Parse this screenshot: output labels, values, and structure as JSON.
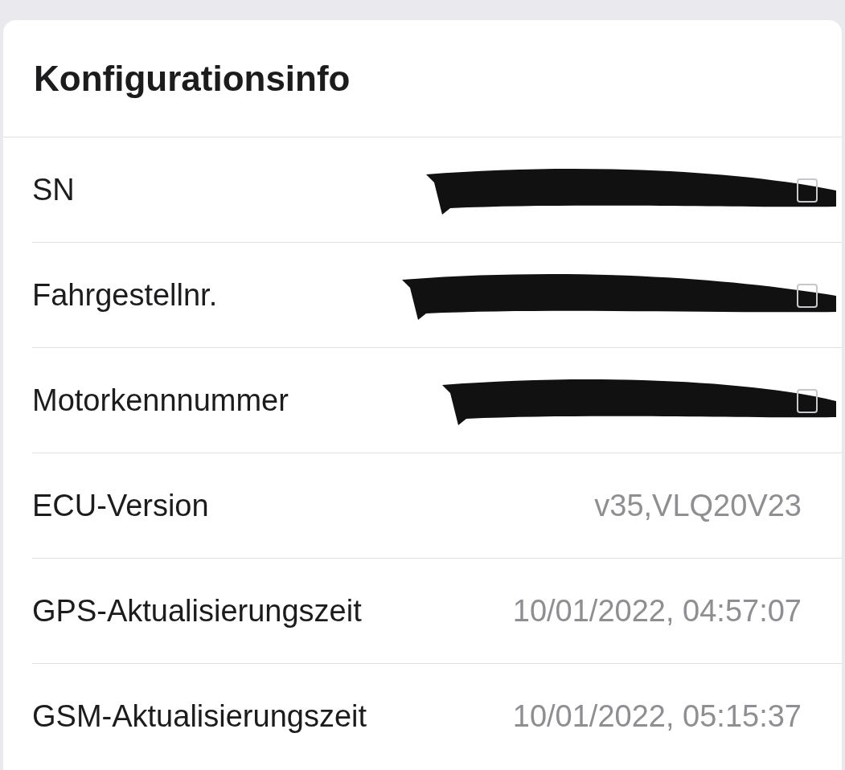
{
  "card": {
    "title": "Konfigurationsinfo",
    "rows": [
      {
        "label": "SN",
        "kind": "redacted"
      },
      {
        "label": "Fahrgestellnr.",
        "kind": "redacted"
      },
      {
        "label": "Motorkennnummer",
        "kind": "redacted"
      },
      {
        "label": "ECU-Version",
        "kind": "text",
        "value": "v35,VLQ20V23"
      },
      {
        "label": "GPS-Aktualisierungszeit",
        "kind": "text",
        "value": "10/01/2022, 04:57:07"
      },
      {
        "label": "GSM-Aktualisierungszeit",
        "kind": "text",
        "value": "10/01/2022, 05:15:37"
      }
    ]
  }
}
